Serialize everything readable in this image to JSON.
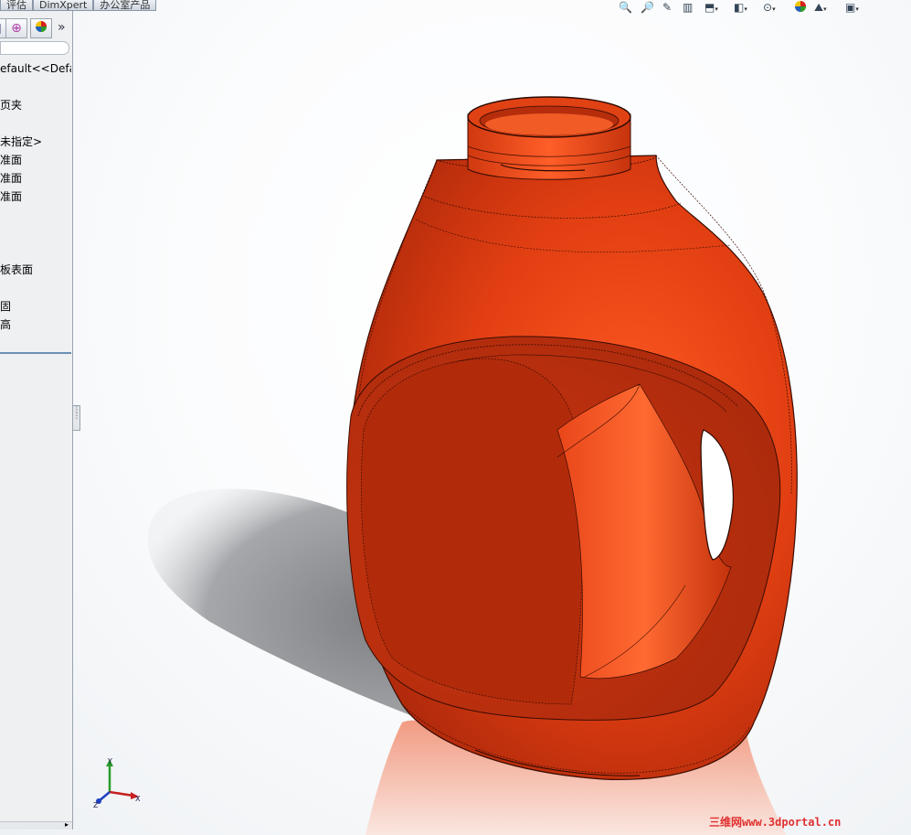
{
  "tabs": [
    {
      "label": "评估"
    },
    {
      "label": "DimXpert"
    },
    {
      "label": "办公室产品"
    }
  ],
  "left_panel": {
    "more_label": "»",
    "tree_items": [
      {
        "label": "efault<<Defa"
      },
      {
        "label": "页夹"
      },
      {
        "label": "未指定>"
      },
      {
        "label": "准面"
      },
      {
        "label": "准面"
      },
      {
        "label": "准面"
      },
      {
        "label": "板表面"
      },
      {
        "label": "固"
      },
      {
        "label": "高"
      }
    ]
  },
  "view_toolbar": {
    "icons": [
      "zoom-to-fit-icon",
      "zoom-to-area-icon",
      "previous-view-icon",
      "section-view-icon",
      "view-orientation-icon",
      "display-style-icon",
      "hide-show-items-icon",
      "edit-appearance-icon",
      "apply-scene-icon",
      "view-settings-icon"
    ]
  },
  "model": {
    "body_color": "#d93a12",
    "shadow_color": "#8c8c8c"
  },
  "triad": {
    "x_label": "X",
    "y_label": "Y",
    "z_label": "Z"
  },
  "watermark": "三维网www.3dportal.cn"
}
